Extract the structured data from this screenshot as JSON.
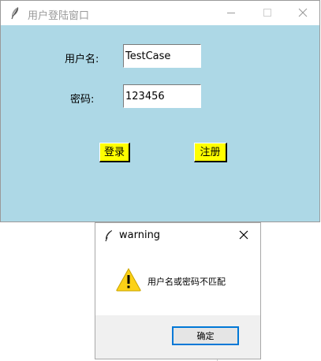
{
  "main_window": {
    "title": "用户登陆窗口",
    "title_icon": "feather-icon",
    "background_color": "#add8e6",
    "controls": {
      "minimize_icon": "minimize-icon",
      "maximize_icon": "maximize-icon",
      "close_icon": "close-icon"
    },
    "form": {
      "username_label": "用户名:",
      "username_value": "TestCase",
      "password_label": "密码:",
      "password_value": "123456",
      "login_label": "登录",
      "register_label": "注册",
      "button_color": "#ffff00"
    }
  },
  "dialog": {
    "title": "warning",
    "title_icon": "feather-icon",
    "close_icon": "close-icon",
    "warning_icon": "warning-triangle-icon",
    "message": "用户名或密码不匹配",
    "ok_label": "确定",
    "accent_color": "#0078d7"
  }
}
